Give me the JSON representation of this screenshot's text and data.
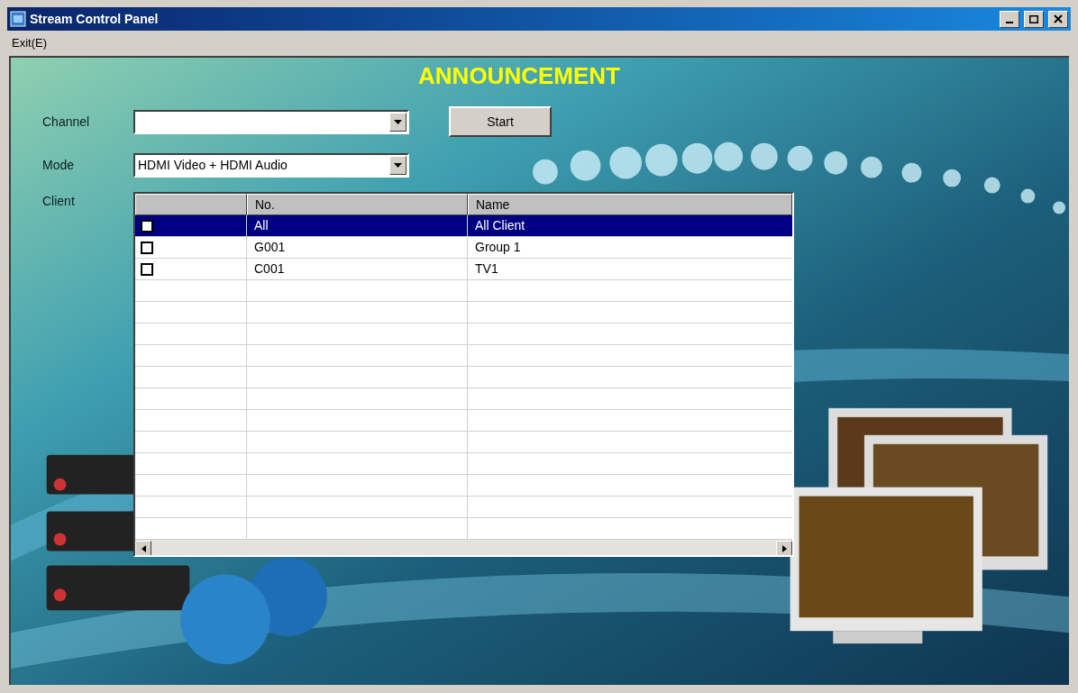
{
  "window": {
    "title": "Stream Control Panel"
  },
  "menu": [
    "Exit(E)"
  ],
  "heading": "ANNOUNCEMENT",
  "fields": [
    {
      "label": "Channel"
    },
    {
      "label": "Mode",
      "value": "HDMI Video + HDMI Audio"
    }
  ],
  "start_button": "Start",
  "client_label": "Client",
  "table": {
    "columns": [
      "No.",
      "Name"
    ],
    "rows": [
      {
        "checked": false,
        "selected": true,
        "no": "All",
        "name": "All Client"
      },
      {
        "checked": false,
        "selected": false,
        "no": "G001",
        "name": "Group 1"
      },
      {
        "checked": false,
        "selected": false,
        "no": "C001",
        "name": "TV1"
      }
    ]
  }
}
